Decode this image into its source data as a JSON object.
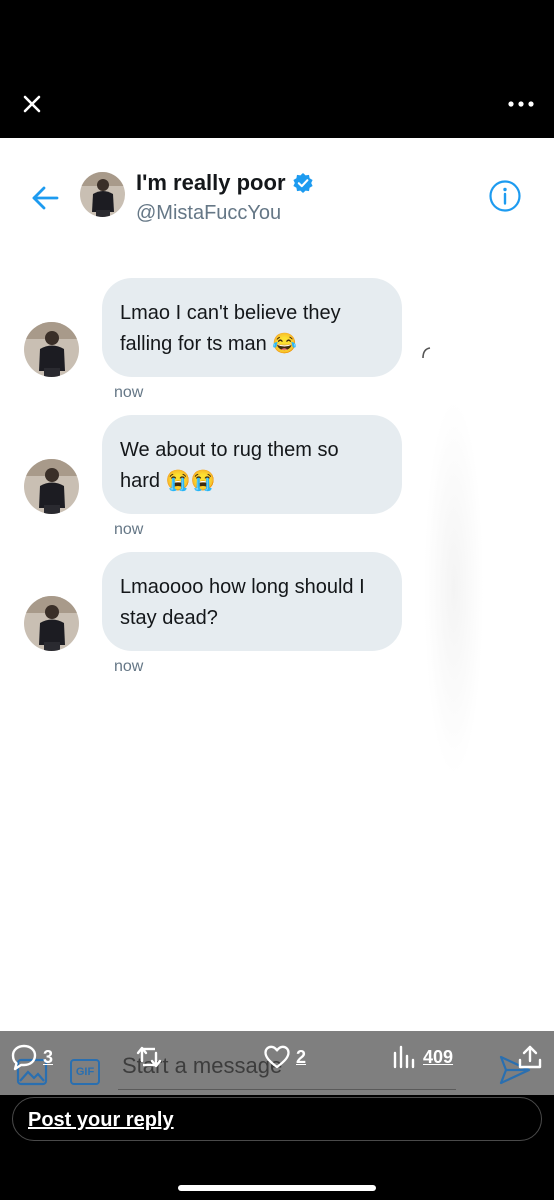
{
  "viewer": {
    "close_icon": "close-icon",
    "more_icon": "more-dots-icon"
  },
  "dm": {
    "name": "I'm really poor",
    "handle": "@MistaFuccYou",
    "verified": true,
    "accent_color": "#1d9bf0",
    "messages": [
      {
        "text": "Lmao I can't believe they falling for ts man 😂",
        "time": "now"
      },
      {
        "text": "We about to rug them so hard 😭😭",
        "time": "now"
      },
      {
        "text": "Lmaoooo how long should I stay dead?",
        "time": "now"
      }
    ],
    "compose_placeholder": "Start a message"
  },
  "stats": {
    "replies": "3",
    "reposts": "",
    "likes": "2",
    "views": "409"
  },
  "reply": {
    "placeholder": "Post your reply"
  }
}
